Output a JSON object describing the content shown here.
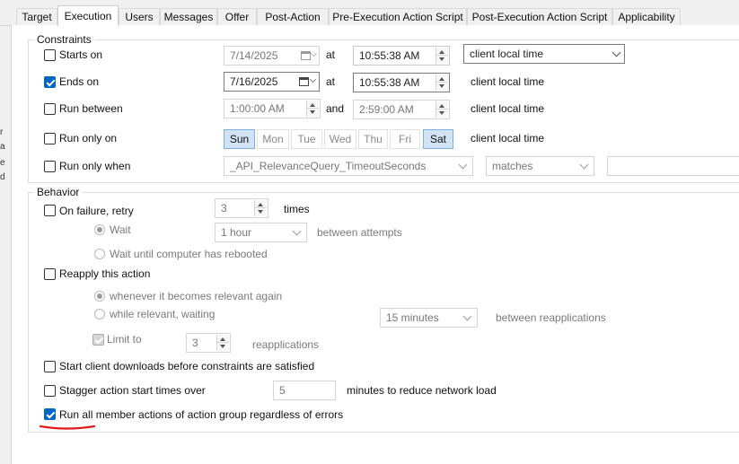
{
  "tabs": [
    "Target",
    "Execution",
    "Users",
    "Messages",
    "Offer",
    "Post-Action",
    "Pre-Execution Action Script",
    "Post-Execution Action Script",
    "Applicability"
  ],
  "active_tab": "Execution",
  "left_edge_fragments": [
    "r",
    "a",
    "e",
    "d"
  ],
  "constraints": {
    "legend": "Constraints",
    "starts_on": {
      "label": "Starts on",
      "checked": false,
      "date": "7/14/2025",
      "at_label": "at",
      "time": "10:55:38 AM",
      "timezone": "client local time"
    },
    "ends_on": {
      "label": "Ends on",
      "checked": true,
      "date": "7/16/2025",
      "at_label": "at",
      "time": "10:55:38 AM",
      "timezone": "client local time"
    },
    "run_between": {
      "label": "Run between",
      "checked": false,
      "from": "1:00:00 AM",
      "and_label": "and",
      "to": "2:59:00 AM",
      "timezone": "client local time"
    },
    "run_only_on": {
      "label": "Run only on",
      "checked": false,
      "days": [
        {
          "label": "Sun",
          "selected": true
        },
        {
          "label": "Mon",
          "selected": false
        },
        {
          "label": "Tue",
          "selected": false
        },
        {
          "label": "Wed",
          "selected": false
        },
        {
          "label": "Thu",
          "selected": false
        },
        {
          "label": "Fri",
          "selected": false
        },
        {
          "label": "Sat",
          "selected": true
        }
      ],
      "timezone": "client local time"
    },
    "run_only_when": {
      "label": "Run only when",
      "checked": false,
      "property": "_API_RelevanceQuery_TimeoutSeconds",
      "operator": "matches",
      "value": ""
    }
  },
  "behavior": {
    "legend": "Behavior",
    "on_failure_retry": {
      "label": "On failure, retry",
      "checked": false,
      "count": "3",
      "times_label": "times",
      "wait_label": "Wait",
      "wait_value": "1 hour",
      "between_label": "between attempts",
      "wait_reboot_label": "Wait until computer has rebooted"
    },
    "reapply": {
      "label": "Reapply this action",
      "checked": false,
      "whenever_label": "whenever it becomes relevant again",
      "while_label": "while relevant, waiting",
      "interval": "15 minutes",
      "between_label": "between reapplications",
      "limit_label": "Limit to",
      "limit_checked": true,
      "limit_value": "3",
      "reapplications_label": "reapplications"
    },
    "start_downloads": {
      "label": "Start client downloads before constraints are satisfied",
      "checked": false
    },
    "stagger": {
      "label": "Stagger action start times over",
      "checked": false,
      "minutes": "5",
      "suffix": "minutes to reduce network load"
    },
    "run_all_members": {
      "label": "Run all member actions of action group regardless of errors",
      "checked": true
    }
  },
  "colors": {
    "accent": "#0067c0",
    "selected_day_bg": "#cfe3f5",
    "annotation": "#e11b1b"
  }
}
